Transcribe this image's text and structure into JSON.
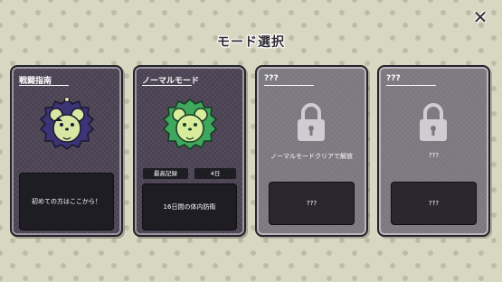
{
  "screen": {
    "title": "モード選択",
    "close_label": "✕"
  },
  "cards": [
    {
      "title": "戦闘指南",
      "description": "初めての方はここから！",
      "character_icon": "purple-hedgehog-mouse-icon",
      "accent_color": "#4b3f85"
    },
    {
      "title": "ノーマルモード",
      "record_label": "最高記録",
      "record_value": "4日",
      "description": "16日間の体内防衛",
      "character_icon": "green-hedgehog-mouse-icon",
      "accent_color": "#3fa85e"
    },
    {
      "title": "???",
      "unlock_condition": "ノーマルモードクリアで解放",
      "description": "???",
      "icon": "lock-icon"
    },
    {
      "title": "???",
      "unlock_condition": "???",
      "description": "???",
      "icon": "lock-icon"
    }
  ]
}
